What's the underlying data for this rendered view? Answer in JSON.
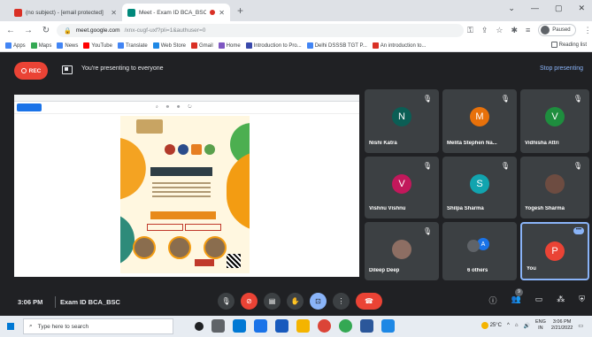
{
  "browser": {
    "tabs": [
      {
        "title": "(no subject) - [email protected]",
        "active": false
      },
      {
        "title": "Meet - Exam ID BCA_BSC",
        "active": true
      }
    ],
    "url_host": "meet.google.com",
    "url_path": "/xnx-cugf-uxf?pli=1&authuser=0",
    "profile_label": "Paused",
    "bookmarks": [
      "Apps",
      "Maps",
      "News",
      "YouTube",
      "Translate",
      "Web Store",
      "Gmail",
      "Home",
      "Introduction to Pro...",
      "Delhi DSSSB TGT P...",
      "An introduction to..."
    ],
    "reading_list": "Reading list"
  },
  "meet": {
    "rec_label": "REC",
    "presenting_text": "You're presenting to everyone",
    "stop_presenting": "Stop presenting",
    "participants": [
      {
        "name": "Nishi Katra",
        "initial": "N",
        "color": "#0b5e55"
      },
      {
        "name": "Melita Stephen Na...",
        "initial": "M",
        "color": "#e8710a"
      },
      {
        "name": "Vidhisha Attri",
        "initial": "V",
        "color": "#1e8e3e"
      },
      {
        "name": "Vishnu Vishnu",
        "initial": "V",
        "color": "#c2185b"
      },
      {
        "name": "Shilpa Sharma",
        "initial": "S",
        "color": "#12a4af"
      },
      {
        "name": "Yogesh Sharma",
        "initial": "",
        "color": "#6d4c41"
      },
      {
        "name": "Dileep Deep",
        "initial": "",
        "color": "#8d6e63"
      },
      {
        "name": "6 others",
        "initial": "A",
        "color": "#1a73e8"
      },
      {
        "name": "You",
        "initial": "P",
        "color": "#ea4335"
      }
    ],
    "time": "3:06 PM",
    "meeting_name": "Exam ID BCA_BSC",
    "people_count": "9"
  },
  "taskbar": {
    "search_placeholder": "Type here to search",
    "temperature": "25°C",
    "language": "ENG",
    "region": "IN",
    "clock_time": "3:06 PM",
    "clock_date": "2/21/2022"
  }
}
